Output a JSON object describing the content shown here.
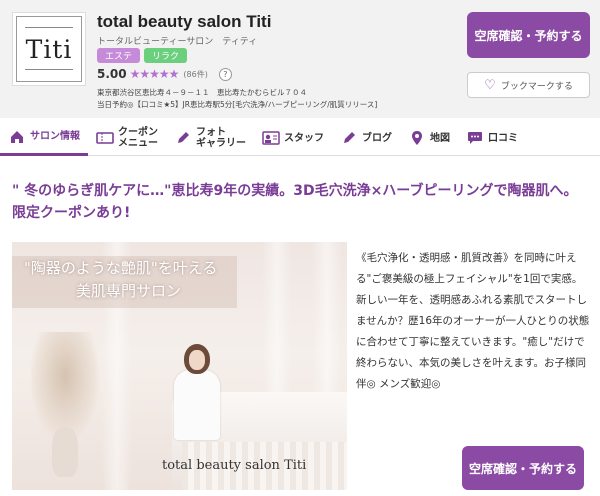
{
  "header": {
    "logo_text": "Titi",
    "salon_name": "total beauty salon Titi",
    "salon_kana": "トータルビューティーサロン　ティティ",
    "tags": [
      "エステ",
      "リラク"
    ],
    "rating_score": "5.00",
    "stars": "★★★★★",
    "rating_count": "(86件)",
    "help": "?",
    "address": "東京都渋谷区恵比寿４－９－１１　恵比寿たかむらビル７０４",
    "access": "当日予約◎【口コミ★5】JR恵比寿駅5分[毛穴洗浄/ハーブピーリング/肌質リリース]",
    "reserve_label": "空席確認・予約する",
    "bookmark_label": "ブックマークする",
    "bookmark_icon": "heart-icon"
  },
  "nav": {
    "items": [
      {
        "label": "サロン情報",
        "icon": "home-icon"
      },
      {
        "label": "クーポン\nメニュー",
        "icon": "ticket-icon"
      },
      {
        "label": "フォト\nギャラリー",
        "icon": "pen-icon"
      },
      {
        "label": "スタッフ",
        "icon": "staff-icon"
      },
      {
        "label": "ブログ",
        "icon": "pencil-icon"
      },
      {
        "label": "地図",
        "icon": "map-pin-icon"
      },
      {
        "label": "口コミ",
        "icon": "chat-icon"
      }
    ]
  },
  "main": {
    "catch": "\" 冬のゆらぎ肌ケアに…\"恵比寿9年の実績。3D毛穴洗浄×ハーブピーリングで陶器肌へ。限定クーポンあり!",
    "hero_title": "\"陶器のような艶肌\"を叶える",
    "hero_sub": "美肌専門サロン",
    "hero_brand": "total beauty salon Titi",
    "description": "《毛穴浄化・透明感・肌質改善》を同時に叶える\"ご褒美級の極上フェイシャル\"を1回で実感。新しい一年を、透明感あふれる素肌でスタートしませんか？歴16年のオーナーが一人ひとりの状態に合わせて丁寧に整えていきます。\"癒し\"だけで終わらない、本気の美しさを叶えます。お子様同伴◎ メンズ歓迎◎",
    "reserve_label": "空席確認・予約する"
  },
  "colors": {
    "accent": "#7a3d96",
    "button": "#8b4aa3",
    "tag_esthe": "#c58bd9",
    "tag_relax": "#6ccf7e"
  }
}
